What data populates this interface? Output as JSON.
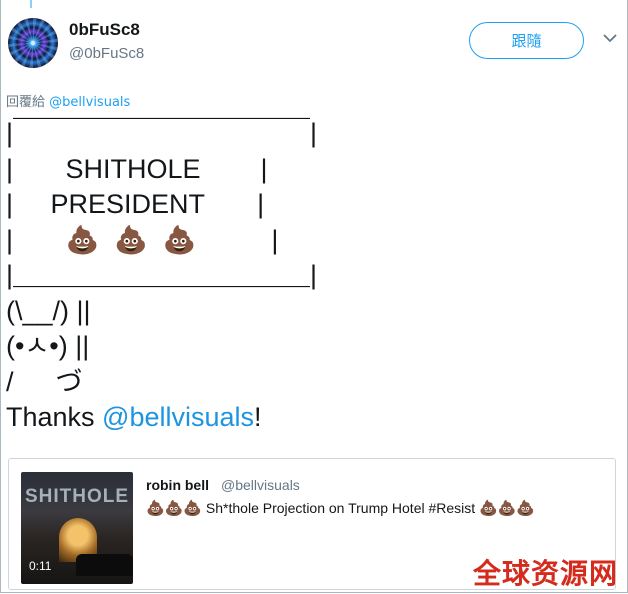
{
  "tweet": {
    "display_name": "0bFuSc8",
    "handle": "@0bFuSc8",
    "follow_label": "跟隨",
    "reply_prefix": "回覆給",
    "reply_to": "@bellvisuals",
    "ascii_art": "|￣￣￣￣￣￣￣￣￣￣￣|\n|       SHITHOLE        |\n|     PRESIDENT       |\n|       💩  💩  💩          |\n|＿＿＿＿＿＿＿＿＿＿＿|\n(\\__/) ||\n(•ㅅ•) ||\n/ 　 づ",
    "thanks_text": "Thanks ",
    "thanks_mention": "@bellvisuals",
    "thanks_suffix": "!"
  },
  "quote": {
    "name": "robin bell",
    "handle": "@bellvisuals",
    "emoji_prefix": "💩💩💩",
    "text": " Sh*thole Projection on Trump Hotel #Resist ",
    "emoji_suffix": "💩💩💩",
    "thumb_word": "SHITHOLE",
    "duration": "0:11"
  },
  "watermark": "全球资源网",
  "colors": {
    "accent": "#1da1f2",
    "watermark": "#d42b1d"
  },
  "icons": {
    "menu": "chevron-down-icon"
  }
}
